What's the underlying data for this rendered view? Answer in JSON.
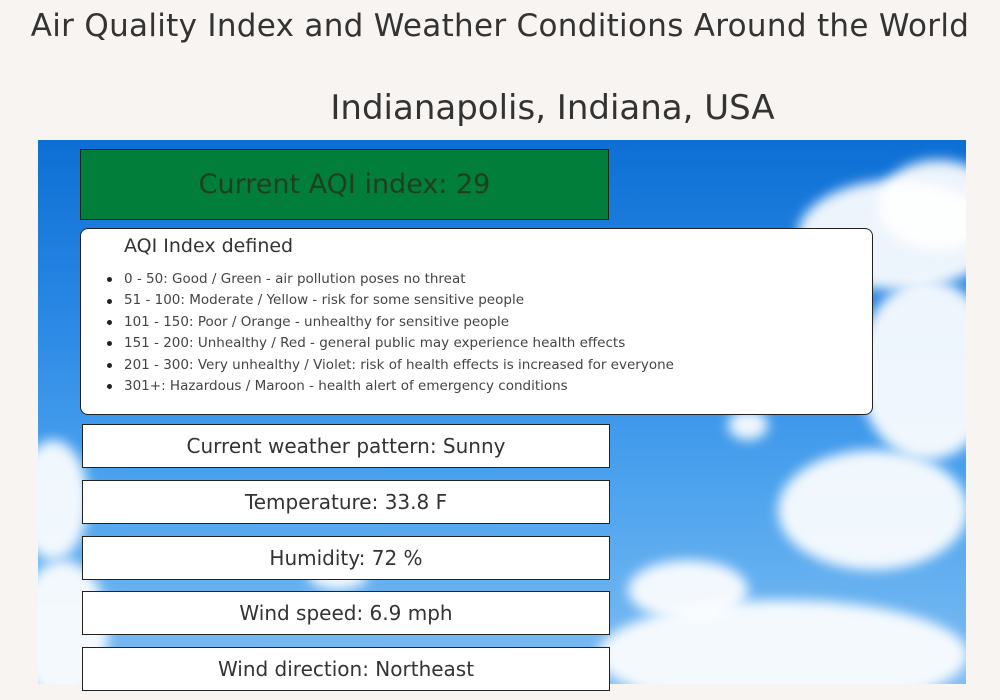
{
  "header": {
    "title": "Air Quality Index and Weather Conditions Around the World",
    "city": "Indianapolis, Indiana, USA"
  },
  "aqi": {
    "text": "Current AQI index: 29",
    "color": "#017e3a"
  },
  "aqi_defined": {
    "title": "AQI Index defined",
    "items": [
      "0 - 50: Good / Green - air pollution poses no threat",
      "51 - 100: Moderate / Yellow - risk for some sensitive people",
      "101 - 150: Poor / Orange - unhealthy for sensitive people",
      "151 - 200: Unhealthy / Red - general public may experience health effects",
      "201 - 300: Very unhealthy / Violet: risk of health effects is increased for everyone",
      "301+: Hazardous / Maroon - health alert of emergency conditions"
    ]
  },
  "weather": {
    "pattern": "Current weather pattern: Sunny",
    "temperature": "Temperature: 33.8 F",
    "humidity": "Humidity: 72 %",
    "wind_speed": "Wind speed: 6.9 mph",
    "wind_direction": "Wind direction: Northeast"
  },
  "colors": {
    "page_bg": "#f8f4f1",
    "sky": "#1d7fe0",
    "good": "#017e3a"
  }
}
